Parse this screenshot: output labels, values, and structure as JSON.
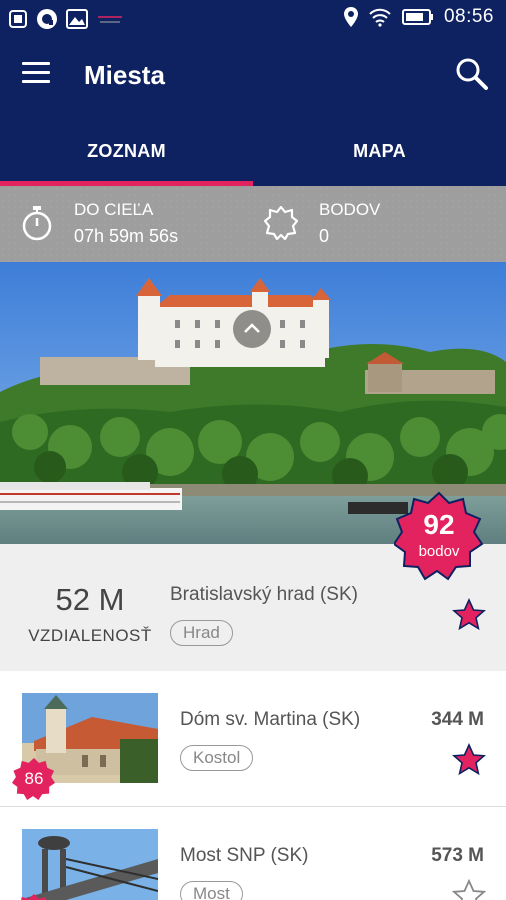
{
  "status_bar": {
    "time": "08:56",
    "icons": [
      "notification-icon",
      "app-icon",
      "gallery-icon",
      "flag-icon",
      "location-icon",
      "wifi-icon",
      "battery-icon"
    ]
  },
  "app_bar": {
    "title": "Miesta",
    "menu_icon": "menu-icon",
    "search_icon": "search-icon"
  },
  "tabs": [
    {
      "label": "ZOZNAM",
      "active": true
    },
    {
      "label": "MAPA",
      "active": false
    }
  ],
  "info_bar": {
    "timer_label": "DO CIEĽA",
    "timer_value": "07h 59m 56s",
    "points_label": "BODOV",
    "points_value": "0"
  },
  "featured": {
    "points": "92",
    "points_label": "bodov",
    "distance_value": "52 M",
    "distance_label": "VZDIALENOSŤ",
    "name": "Bratislavský hrad (SK)",
    "category": "Hrad",
    "favorite": true
  },
  "places": [
    {
      "name": "Dóm sv. Martina (SK)",
      "category": "Kostol",
      "distance": "344 M",
      "points": "86",
      "favorite": true
    },
    {
      "name": "Most SNP (SK)",
      "category": "Most",
      "distance": "573 M",
      "points": "",
      "favorite": false
    }
  ],
  "colors": {
    "primary": "#0e2160",
    "accent": "#e3235f",
    "info_bar": "#9e9e9e"
  }
}
